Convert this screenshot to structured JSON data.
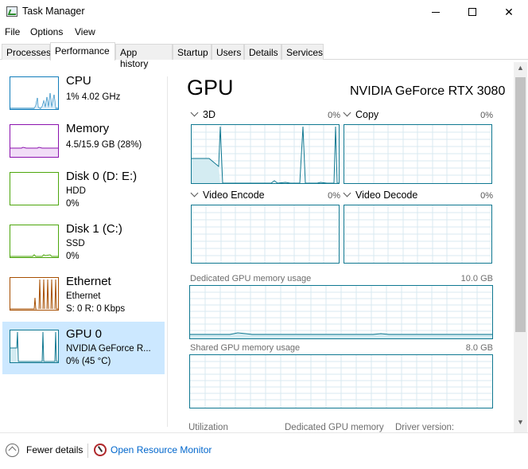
{
  "window": {
    "title": "Task Manager"
  },
  "menu": [
    "File",
    "Options",
    "View"
  ],
  "tabs": [
    "Processes",
    "Performance",
    "App history",
    "Startup",
    "Users",
    "Details",
    "Services"
  ],
  "active_tab": "Performance",
  "sidebar": {
    "items": [
      {
        "title": "CPU",
        "line1": "1%  4.02 GHz",
        "line2": "",
        "color": "#117dbb"
      },
      {
        "title": "Memory",
        "line1": "4.5/15.9 GB (28%)",
        "line2": "",
        "color": "#8b12ae"
      },
      {
        "title": "Disk 0 (D: E:)",
        "line1": "HDD",
        "line2": "0%",
        "color": "#4da60c"
      },
      {
        "title": "Disk 1 (C:)",
        "line1": "SSD",
        "line2": "0%",
        "color": "#4da60c"
      },
      {
        "title": "Ethernet",
        "line1": "Ethernet",
        "line2": "S: 0  R: 0 Kbps",
        "color": "#a74f01"
      },
      {
        "title": "GPU 0",
        "line1": "NVIDIA GeForce R...",
        "line2": "0%  (45 °C)",
        "color": "#0f7891"
      }
    ],
    "selected_index": 5
  },
  "main": {
    "title": "GPU",
    "device": "NVIDIA GeForce RTX 3080",
    "engines": [
      {
        "label": "3D",
        "percent": "0%"
      },
      {
        "label": "Copy",
        "percent": "0%"
      },
      {
        "label": "Video Encode",
        "percent": "0%"
      },
      {
        "label": "Video Decode",
        "percent": "0%"
      }
    ],
    "dedicated_memory": {
      "label": "Dedicated GPU memory usage",
      "value": "10.0 GB"
    },
    "shared_memory": {
      "label": "Shared GPU memory usage",
      "value": "8.0 GB"
    },
    "bottom_labels": [
      "Utilization",
      "Dedicated GPU memory",
      "Driver version:"
    ]
  },
  "footer": {
    "fewer_details": "Fewer details",
    "open_resource_monitor": "Open Resource Monitor"
  },
  "colors": {
    "gpu_accent": "#0f7891",
    "selected_bg": "#cce8ff",
    "link": "#0066cc"
  }
}
